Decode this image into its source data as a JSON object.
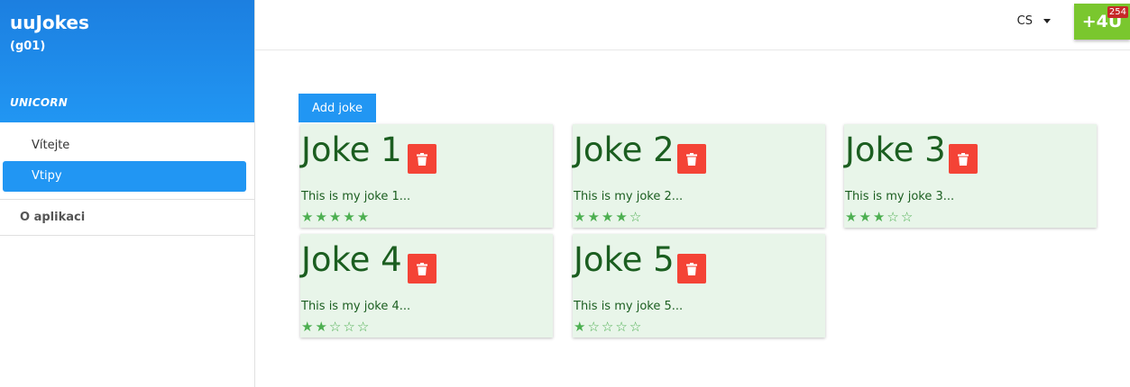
{
  "sidebar": {
    "title": "uuJokes",
    "subtitle": "(g01)",
    "brand": "UNICORN",
    "items": [
      {
        "label": "Vítejte",
        "active": false
      },
      {
        "label": "Vtipy",
        "active": true
      }
    ],
    "about": "O aplikaci"
  },
  "topbar": {
    "language": "CS",
    "plus4u_label": "+4U",
    "plus4u_badge": "254"
  },
  "main": {
    "add_label": "Add joke",
    "jokes": [
      {
        "title": "Joke 1",
        "text": "This is my joke 1...",
        "rating": 5,
        "max_rating": 5
      },
      {
        "title": "Joke 2",
        "text": "This is my joke 2...",
        "rating": 4,
        "max_rating": 5
      },
      {
        "title": "Joke 3",
        "text": "This is my joke 3...",
        "rating": 3,
        "max_rating": 5
      },
      {
        "title": "Joke 4",
        "text": "This is my joke 4...",
        "rating": 2,
        "max_rating": 5
      },
      {
        "title": "Joke 5",
        "text": "This is my joke 5...",
        "rating": 1,
        "max_rating": 5
      }
    ]
  },
  "colors": {
    "primary": "#2196f3",
    "card_bg": "#e8f5e9",
    "text_green": "#1b5e20",
    "star": "#4caf50",
    "delete": "#f44336",
    "plus4u": "#7ac72e"
  },
  "icons": {
    "delete": "trash-icon",
    "star_full": "star-filled-icon",
    "star_empty": "star-outline-icon",
    "language": "caret-down-icon"
  }
}
